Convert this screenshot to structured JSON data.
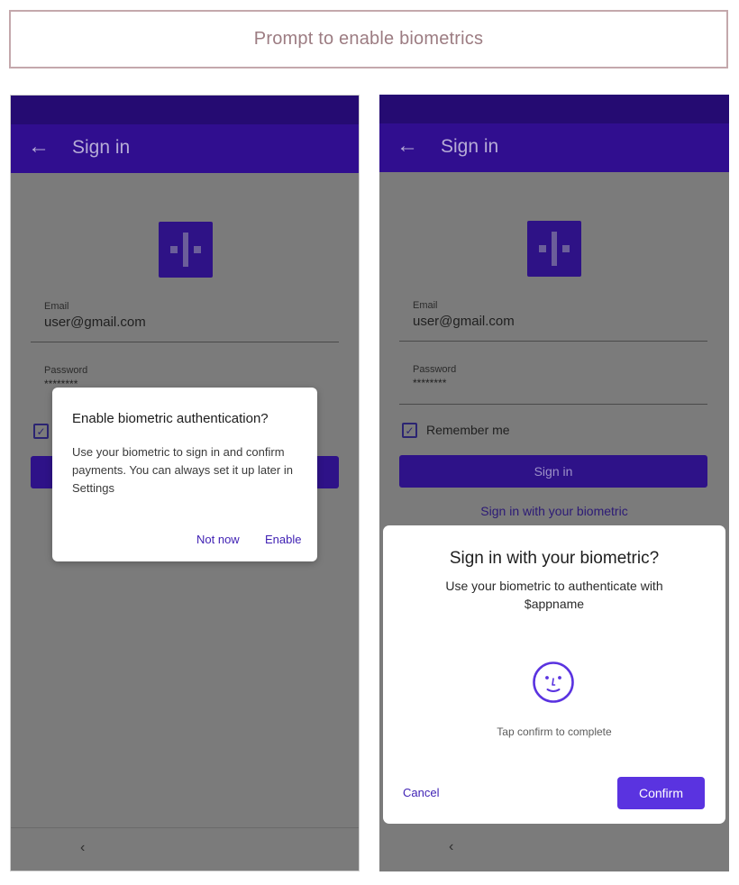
{
  "caption": "Prompt to enable biometrics",
  "app_bar": {
    "back_icon": "arrow-back-icon",
    "title": "Sign in"
  },
  "form": {
    "email_label": "Email",
    "email_value": "user@gmail.com",
    "password_label": "Password",
    "password_value": "********",
    "remember_label": "Remember me",
    "signin_button": "Sign in",
    "biometric_link": "Sign in with your biometric"
  },
  "left_dialog": {
    "title": "Enable biometric authentication?",
    "body": "Use your biometric to sign in and confirm payments. You can always set it up later in Settings",
    "not_now": "Not now",
    "enable": "Enable"
  },
  "biometric_sheet": {
    "title": "Sign in with your biometric?",
    "subtitle": "Use your biometric to authenticate with $appname",
    "icon": "face-icon",
    "hint": "Tap confirm to complete",
    "cancel": "Cancel",
    "confirm": "Confirm"
  },
  "nav": {
    "back_icon": "chevron-left-icon"
  },
  "colors": {
    "primary_dark": "#250b72",
    "primary": "#300e8f",
    "accent": "#5a33e0",
    "scrim": "#7b7b7b"
  }
}
